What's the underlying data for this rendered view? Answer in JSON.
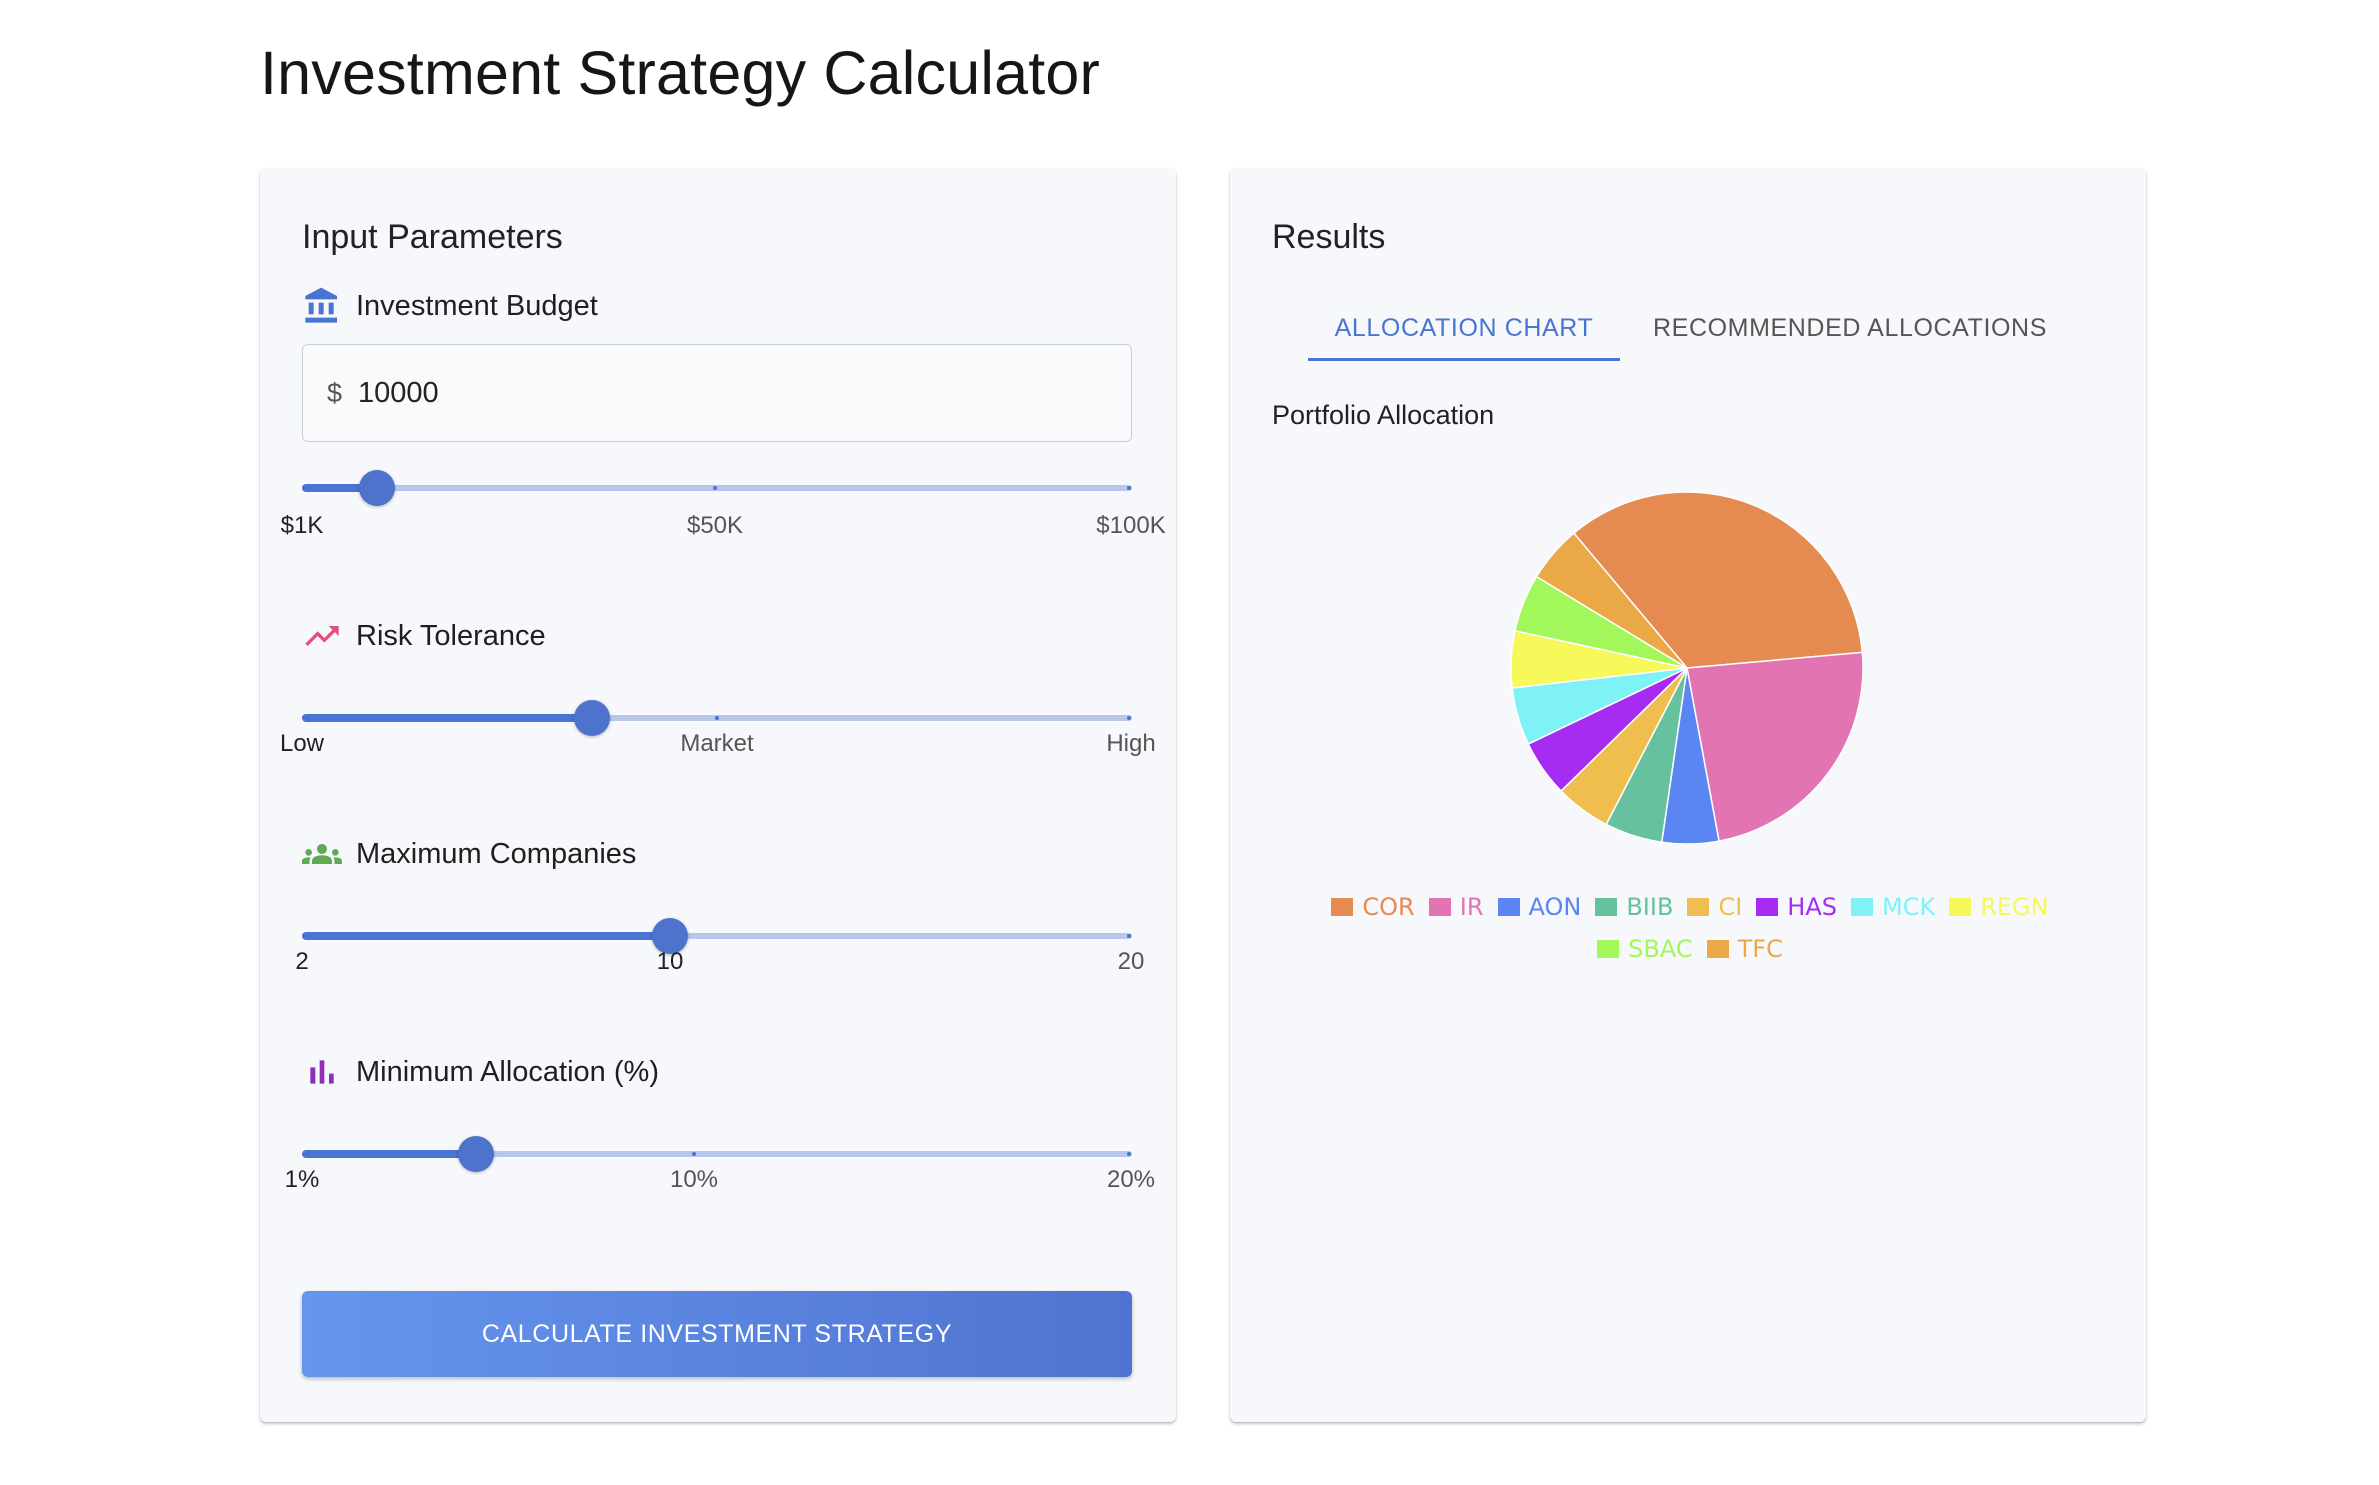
{
  "page": {
    "title": "Investment Strategy Calculator"
  },
  "inputs": {
    "title": "Input Parameters",
    "budget": {
      "label": "Investment Budget",
      "icon": "bank-icon",
      "prefix": "$",
      "value": "10000",
      "slider": {
        "min": 1000,
        "max": 100000,
        "value": 10000,
        "marks": [
          "$1K",
          "$50K",
          "$100K"
        ]
      }
    },
    "risk": {
      "label": "Risk Tolerance",
      "icon": "trending-up-icon",
      "slider": {
        "min": 0,
        "max": 100,
        "value": 35,
        "marks": [
          "Low",
          "Market",
          "High"
        ]
      }
    },
    "companies": {
      "label": "Maximum Companies",
      "icon": "groups-icon",
      "slider": {
        "min": 2,
        "max": 20,
        "value": 10,
        "marks": [
          "2",
          "10",
          "20"
        ]
      }
    },
    "allocation": {
      "label": "Minimum Allocation (%)",
      "icon": "bar-chart-icon",
      "slider": {
        "min": 1,
        "max": 20,
        "value": 5,
        "marks": [
          "1%",
          "10%",
          "20%"
        ]
      }
    },
    "calculate_label": "CALCULATE INVESTMENT STRATEGY"
  },
  "results": {
    "title": "Results",
    "tabs": [
      {
        "label": "ALLOCATION CHART",
        "active": true
      },
      {
        "label": "RECOMMENDED ALLOCATIONS",
        "active": false
      }
    ]
  },
  "chart_data": {
    "type": "pie",
    "title": "Portfolio Allocation",
    "categories": [
      "COR",
      "IR",
      "AON",
      "BIIB",
      "CI",
      "HAS",
      "MCK",
      "REGN",
      "SBAC",
      "TFC"
    ],
    "values": [
      34.7,
      23.5,
      5.2,
      5.3,
      5.1,
      5.2,
      5.3,
      5.2,
      5.3,
      5.2
    ],
    "colors": [
      "#e58a50",
      "#e374b4",
      "#5b85f0",
      "#66c29e",
      "#efbe4e",
      "#a52cf0",
      "#7ff2f8",
      "#f7f85a",
      "#a2f85a",
      "#eba847"
    ],
    "legend_position": "bottom"
  },
  "colors": {
    "accent": "#4a74d1",
    "card_bg": "#f7f8fb"
  }
}
